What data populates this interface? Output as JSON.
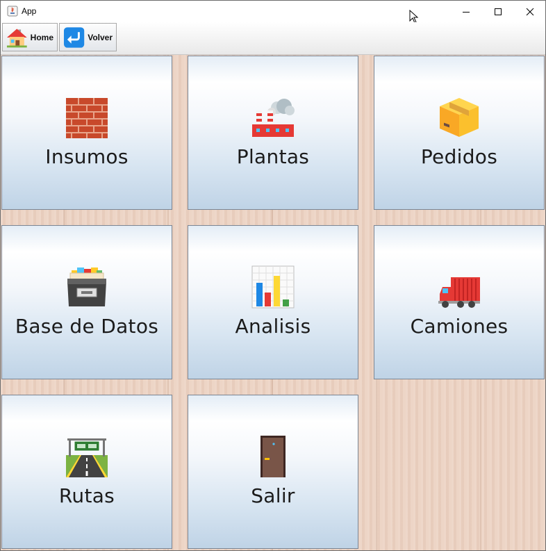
{
  "window": {
    "title": "App",
    "controls": [
      "minimize-icon",
      "maximize-icon",
      "close-icon"
    ]
  },
  "toolbar": {
    "home_label": "Home",
    "back_label": "Volver"
  },
  "menu": {
    "tiles": [
      {
        "label": "Insumos",
        "icon": "brick-wall-icon"
      },
      {
        "label": "Plantas",
        "icon": "factory-icon"
      },
      {
        "label": "Pedidos",
        "icon": "package-box-icon"
      },
      {
        "label": "Base de Datos",
        "icon": "card-file-box-icon"
      },
      {
        "label": "Analisis",
        "icon": "bar-chart-icon"
      },
      {
        "label": "Camiones",
        "icon": "truck-icon"
      },
      {
        "label": "Rutas",
        "icon": "road-icon"
      },
      {
        "label": "Salir",
        "icon": "door-icon"
      }
    ]
  }
}
